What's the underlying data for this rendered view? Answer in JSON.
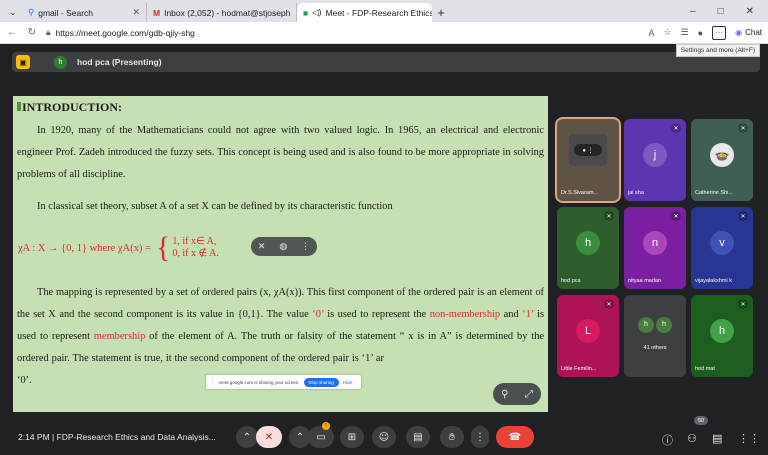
{
  "browser": {
    "tabs": [
      {
        "label": "gmail - Search",
        "icon": "search-icon",
        "active": false
      },
      {
        "label": "Inbox (2,052) - hodmat@stjoseph",
        "icon": "gmail-icon",
        "active": false
      },
      {
        "label": "Meet - FDP-Research Ethics",
        "icon": "meet-icon",
        "active": true
      }
    ],
    "new_tab": "+",
    "address": "https://meet.google.com/gdb-qjiy-shg",
    "window_controls": [
      "–",
      "□",
      "✕"
    ],
    "chat_label": "Chat",
    "tooltip": "Settings and more (Alt+F)"
  },
  "meet": {
    "presenting_label": "hod pca (Presenting)",
    "presenter_initial": "h",
    "meeting_info": "2:14 PM  |  FDP-Research Ethics and Data Analysis...",
    "participant_count": "50",
    "colors": {
      "bg": "#202124",
      "end_call": "#ea4335",
      "mute": "#f9dedc"
    }
  },
  "slide": {
    "title": "INTRODUCTION:",
    "para1": "In 1920, many of the Mathematicians could not agree with two valued logic.  In 1965, an electrical and electronic engineer Prof. Zadeh introduced the fuzzy sets.  This concept is being used and is also found to be more appropriate in solving problems of all discipline.",
    "para2": "In classical set theory, subset A of a set X can be defined by its characteristic function",
    "formula": {
      "lhs": "χA : X → {0, 1}  where  χA(x) =",
      "case1": "1, if x∈ A,",
      "case2": "0, if x ∉ A."
    },
    "para3_a": "The mapping is represented by a set of ordered pairs (x, χA(x)).  This first component of the ordered pair is an element of the set X and the second component is its value in {0,1}.  The value ",
    "para3_r1": "‘0’",
    "para3_b": " is used to represent the ",
    "para3_r2": "non-membership",
    "para3_c": " and ",
    "para3_r3": "‘1’",
    "para3_d": " is used to represent ",
    "para3_r4": "membership",
    "para3_e": " of the element of A.  The truth or falsity of the statement “ x is in A” is determined by the ordered pair.  The statement is true, it the second component of the ordered pair is ‘1’ ar",
    "para3_tail": "‘0’.",
    "share_bar": {
      "text": "meet.google.com is sharing your screen.",
      "stop": "Stop sharing",
      "hide": "Hide"
    }
  },
  "participants": [
    {
      "name": "Dr.S.Sivaram...",
      "initial": "",
      "color": "#6b5a4a",
      "speaking": true,
      "video": true,
      "muted": false
    },
    {
      "name": "jai sha",
      "initial": "j",
      "color": "#7e57c2",
      "tile": "#5e35b1",
      "muted": true
    },
    {
      "name": "Catherine Shi...",
      "initial": "",
      "color": "#4e6b5e",
      "tile": "#3f5f55",
      "muted": true,
      "emoji": "🍲"
    },
    {
      "name": "hod pca",
      "initial": "h",
      "color": "#388e3c",
      "tile": "#2e5e2c",
      "muted": true
    },
    {
      "name": "nityaa madan",
      "initial": "n",
      "color": "#ab47bc",
      "tile": "#7b1fa2",
      "muted": true
    },
    {
      "name": "vijayalakshmi k",
      "initial": "v",
      "color": "#3f51b5",
      "tile": "#283593",
      "muted": true
    },
    {
      "name": "Little Femilin...",
      "initial": "L",
      "color": "#d81b60",
      "tile": "#ad1457",
      "muted": true
    },
    {
      "name": "41 others",
      "initial": "h",
      "tile": "#3c4043",
      "others": true
    },
    {
      "name": "hod mat",
      "initial": "h",
      "color": "#43a047",
      "tile": "#1b5e20",
      "muted": true
    }
  ]
}
